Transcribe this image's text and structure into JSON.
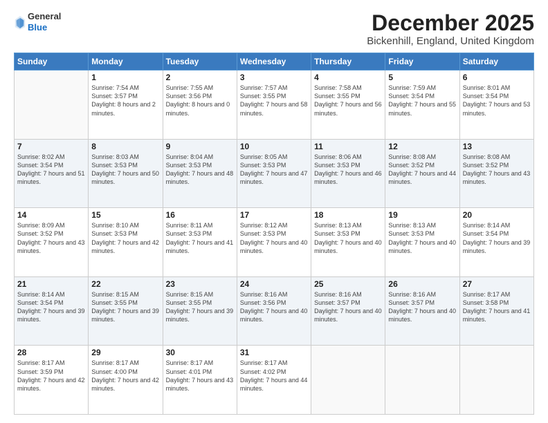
{
  "header": {
    "logo_line1": "General",
    "logo_line2": "Blue",
    "month_title": "December 2025",
    "location": "Bickenhill, England, United Kingdom"
  },
  "days_of_week": [
    "Sunday",
    "Monday",
    "Tuesday",
    "Wednesday",
    "Thursday",
    "Friday",
    "Saturday"
  ],
  "weeks": [
    [
      {
        "day": "",
        "sunrise": "",
        "sunset": "",
        "daylight": ""
      },
      {
        "day": "1",
        "sunrise": "Sunrise: 7:54 AM",
        "sunset": "Sunset: 3:57 PM",
        "daylight": "Daylight: 8 hours and 2 minutes."
      },
      {
        "day": "2",
        "sunrise": "Sunrise: 7:55 AM",
        "sunset": "Sunset: 3:56 PM",
        "daylight": "Daylight: 8 hours and 0 minutes."
      },
      {
        "day": "3",
        "sunrise": "Sunrise: 7:57 AM",
        "sunset": "Sunset: 3:55 PM",
        "daylight": "Daylight: 7 hours and 58 minutes."
      },
      {
        "day": "4",
        "sunrise": "Sunrise: 7:58 AM",
        "sunset": "Sunset: 3:55 PM",
        "daylight": "Daylight: 7 hours and 56 minutes."
      },
      {
        "day": "5",
        "sunrise": "Sunrise: 7:59 AM",
        "sunset": "Sunset: 3:54 PM",
        "daylight": "Daylight: 7 hours and 55 minutes."
      },
      {
        "day": "6",
        "sunrise": "Sunrise: 8:01 AM",
        "sunset": "Sunset: 3:54 PM",
        "daylight": "Daylight: 7 hours and 53 minutes."
      }
    ],
    [
      {
        "day": "7",
        "sunrise": "Sunrise: 8:02 AM",
        "sunset": "Sunset: 3:54 PM",
        "daylight": "Daylight: 7 hours and 51 minutes."
      },
      {
        "day": "8",
        "sunrise": "Sunrise: 8:03 AM",
        "sunset": "Sunset: 3:53 PM",
        "daylight": "Daylight: 7 hours and 50 minutes."
      },
      {
        "day": "9",
        "sunrise": "Sunrise: 8:04 AM",
        "sunset": "Sunset: 3:53 PM",
        "daylight": "Daylight: 7 hours and 48 minutes."
      },
      {
        "day": "10",
        "sunrise": "Sunrise: 8:05 AM",
        "sunset": "Sunset: 3:53 PM",
        "daylight": "Daylight: 7 hours and 47 minutes."
      },
      {
        "day": "11",
        "sunrise": "Sunrise: 8:06 AM",
        "sunset": "Sunset: 3:53 PM",
        "daylight": "Daylight: 7 hours and 46 minutes."
      },
      {
        "day": "12",
        "sunrise": "Sunrise: 8:08 AM",
        "sunset": "Sunset: 3:52 PM",
        "daylight": "Daylight: 7 hours and 44 minutes."
      },
      {
        "day": "13",
        "sunrise": "Sunrise: 8:08 AM",
        "sunset": "Sunset: 3:52 PM",
        "daylight": "Daylight: 7 hours and 43 minutes."
      }
    ],
    [
      {
        "day": "14",
        "sunrise": "Sunrise: 8:09 AM",
        "sunset": "Sunset: 3:52 PM",
        "daylight": "Daylight: 7 hours and 43 minutes."
      },
      {
        "day": "15",
        "sunrise": "Sunrise: 8:10 AM",
        "sunset": "Sunset: 3:53 PM",
        "daylight": "Daylight: 7 hours and 42 minutes."
      },
      {
        "day": "16",
        "sunrise": "Sunrise: 8:11 AM",
        "sunset": "Sunset: 3:53 PM",
        "daylight": "Daylight: 7 hours and 41 minutes."
      },
      {
        "day": "17",
        "sunrise": "Sunrise: 8:12 AM",
        "sunset": "Sunset: 3:53 PM",
        "daylight": "Daylight: 7 hours and 40 minutes."
      },
      {
        "day": "18",
        "sunrise": "Sunrise: 8:13 AM",
        "sunset": "Sunset: 3:53 PM",
        "daylight": "Daylight: 7 hours and 40 minutes."
      },
      {
        "day": "19",
        "sunrise": "Sunrise: 8:13 AM",
        "sunset": "Sunset: 3:53 PM",
        "daylight": "Daylight: 7 hours and 40 minutes."
      },
      {
        "day": "20",
        "sunrise": "Sunrise: 8:14 AM",
        "sunset": "Sunset: 3:54 PM",
        "daylight": "Daylight: 7 hours and 39 minutes."
      }
    ],
    [
      {
        "day": "21",
        "sunrise": "Sunrise: 8:14 AM",
        "sunset": "Sunset: 3:54 PM",
        "daylight": "Daylight: 7 hours and 39 minutes."
      },
      {
        "day": "22",
        "sunrise": "Sunrise: 8:15 AM",
        "sunset": "Sunset: 3:55 PM",
        "daylight": "Daylight: 7 hours and 39 minutes."
      },
      {
        "day": "23",
        "sunrise": "Sunrise: 8:15 AM",
        "sunset": "Sunset: 3:55 PM",
        "daylight": "Daylight: 7 hours and 39 minutes."
      },
      {
        "day": "24",
        "sunrise": "Sunrise: 8:16 AM",
        "sunset": "Sunset: 3:56 PM",
        "daylight": "Daylight: 7 hours and 40 minutes."
      },
      {
        "day": "25",
        "sunrise": "Sunrise: 8:16 AM",
        "sunset": "Sunset: 3:57 PM",
        "daylight": "Daylight: 7 hours and 40 minutes."
      },
      {
        "day": "26",
        "sunrise": "Sunrise: 8:16 AM",
        "sunset": "Sunset: 3:57 PM",
        "daylight": "Daylight: 7 hours and 40 minutes."
      },
      {
        "day": "27",
        "sunrise": "Sunrise: 8:17 AM",
        "sunset": "Sunset: 3:58 PM",
        "daylight": "Daylight: 7 hours and 41 minutes."
      }
    ],
    [
      {
        "day": "28",
        "sunrise": "Sunrise: 8:17 AM",
        "sunset": "Sunset: 3:59 PM",
        "daylight": "Daylight: 7 hours and 42 minutes."
      },
      {
        "day": "29",
        "sunrise": "Sunrise: 8:17 AM",
        "sunset": "Sunset: 4:00 PM",
        "daylight": "Daylight: 7 hours and 42 minutes."
      },
      {
        "day": "30",
        "sunrise": "Sunrise: 8:17 AM",
        "sunset": "Sunset: 4:01 PM",
        "daylight": "Daylight: 7 hours and 43 minutes."
      },
      {
        "day": "31",
        "sunrise": "Sunrise: 8:17 AM",
        "sunset": "Sunset: 4:02 PM",
        "daylight": "Daylight: 7 hours and 44 minutes."
      },
      {
        "day": "",
        "sunrise": "",
        "sunset": "",
        "daylight": ""
      },
      {
        "day": "",
        "sunrise": "",
        "sunset": "",
        "daylight": ""
      },
      {
        "day": "",
        "sunrise": "",
        "sunset": "",
        "daylight": ""
      }
    ]
  ]
}
